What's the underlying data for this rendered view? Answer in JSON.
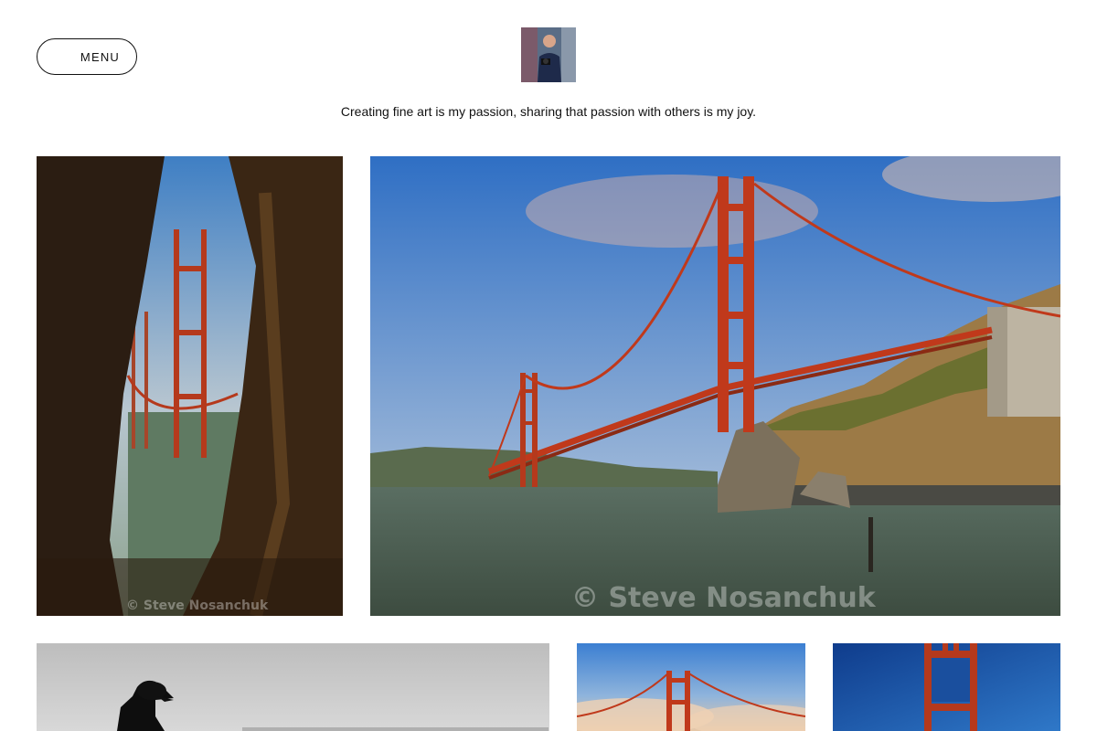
{
  "header": {
    "menu_label": "MENU",
    "tagline": "Creating fine art is my passion, sharing that passion with others is my joy."
  },
  "gallery": {
    "watermark": "© Steve Nosanchuk",
    "photos": [
      {
        "name": "golden-gate-through-trees"
      },
      {
        "name": "golden-gate-bridge-landscape"
      },
      {
        "name": "black-and-white-figure"
      },
      {
        "name": "golden-gate-tower-fog"
      },
      {
        "name": "golden-gate-tower-blue"
      }
    ]
  },
  "colors": {
    "bridge": "#c0391b",
    "sky": "#4a86c8",
    "water": "#4c5f4c"
  }
}
